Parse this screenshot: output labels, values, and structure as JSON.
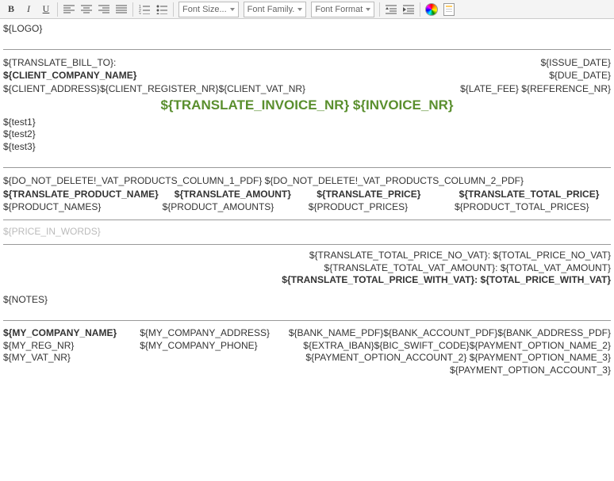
{
  "toolbar": {
    "font_size": "Font Size...",
    "font_family": "Font Family.",
    "font_format": "Font Format"
  },
  "doc": {
    "logo": "${LOGO}",
    "bill_to_label": "${TRANSLATE_BILL_TO}:",
    "client_company": "${CLIENT_COMPANY_NAME}",
    "client_address": "${CLIENT_ADDRESS}",
    "client_reg_nr": "${CLIENT_REGISTER_NR}",
    "client_vat_nr": "${CLIENT_VAT_NR}",
    "issue_date": "${ISSUE_DATE}",
    "due_date": "${DUE_DATE}",
    "late_fee": "${LATE_FEE}",
    "reference_nr": "${REFERENCE_NR}",
    "invoice_title_label": "${TRANSLATE_INVOICE_NR}",
    "invoice_title_nr": "${INVOICE_NR}",
    "test1": "${test1}",
    "test2": "${test2}",
    "test3": "${test3}",
    "col1_marker": "${DO_NOT_DELETE!_VAT_PRODUCTS_COLUMN_1_PDF}",
    "col2_marker": "${DO_NOT_DELETE!_VAT_PRODUCTS_COLUMN_2_PDF}",
    "th_product": "${TRANSLATE_PRODUCT_NAME}",
    "th_amount": "${TRANSLATE_AMOUNT}",
    "th_price": "${TRANSLATE_PRICE}",
    "th_total": "${TRANSLATE_TOTAL_PRICE}",
    "td_product": "${PRODUCT_NAMES}",
    "td_amount": "${PRODUCT_AMOUNTS}",
    "td_price": "${PRODUCT_PRICES}",
    "td_total": "${PRODUCT_TOTAL_PRICES}",
    "price_in_words": "${PRICE_IN_WORDS}",
    "tot_no_vat_label": "${TRANSLATE_TOTAL_PRICE_NO_VAT}:",
    "tot_no_vat_val": "${TOTAL_PRICE_NO_VAT}",
    "tot_vat_amt_label": "${TRANSLATE_TOTAL_VAT_AMOUNT}:",
    "tot_vat_amt_val": "${TOTAL_VAT_AMOUNT}",
    "tot_with_vat_label": "${TRANSLATE_TOTAL_PRICE_WITH_VAT}:",
    "tot_with_vat_val": "${TOTAL_PRICE_WITH_VAT}",
    "notes": "${NOTES}",
    "my_company": "${MY_COMPANY_NAME}",
    "my_reg_nr": "${MY_REG_NR}",
    "my_vat_nr": "${MY_VAT_NR}",
    "my_address": "${MY_COMPANY_ADDRESS}",
    "my_phone": "${MY_COMPANY_PHONE}",
    "bank_name": "${BANK_NAME_PDF}",
    "bank_account": "${BANK_ACCOUNT_PDF}",
    "bank_address": "${BANK_ADDRESS_PDF}",
    "extra_iban": "${EXTRA_IBAN}",
    "bic_swift": "${BIC_SWIFT_CODE}",
    "pay_opt_name2": "${PAYMENT_OPTION_NAME_2}",
    "pay_opt_acct2": "${PAYMENT_OPTION_ACCOUNT_2}",
    "pay_opt_name3": "${PAYMENT_OPTION_NAME_3}",
    "pay_opt_acct3": "${PAYMENT_OPTION_ACCOUNT_3}"
  }
}
